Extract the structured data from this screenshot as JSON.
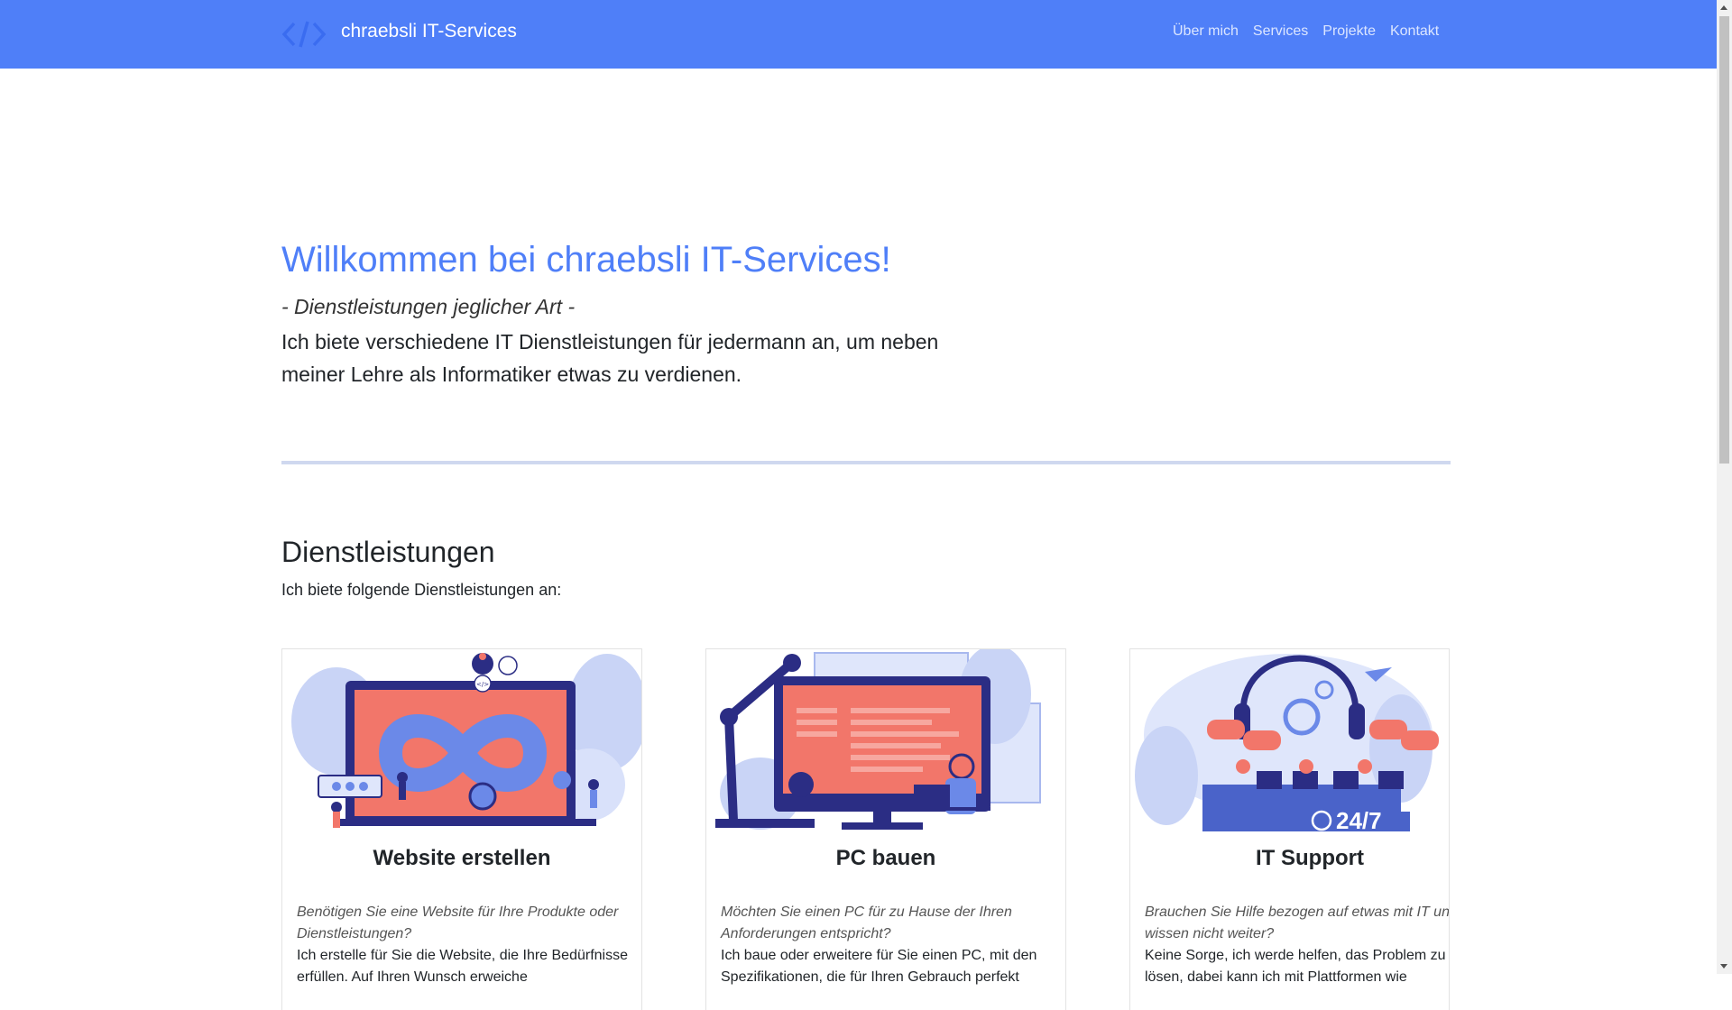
{
  "brand": {
    "name": "chraebsli IT-Services",
    "logo_icon": "code-brackets-icon"
  },
  "nav": {
    "items": [
      "Über mich",
      "Services",
      "Projekte",
      "Kontakt"
    ]
  },
  "hero": {
    "title": "Willkommen bei chraebsli IT-Services!",
    "subtitle": "- Dienstleistungen jeglicher Art -",
    "text": "Ich biete verschiedene IT Dienstleistungen für jedermann an, um neben meiner Lehre als Informatiker etwas zu verdienen."
  },
  "services": {
    "title": "Dienstleistungen",
    "subtitle": "Ich biete folgende Dienstleistungen an:",
    "cards": [
      {
        "title": "Website erstellen",
        "question": "Benötigen Sie eine Website für Ihre Produkte oder Dienstleistungen?",
        "body": "Ich erstelle für Sie die Website, die Ihre Bedürfnisse erfüllen. Auf Ihren Wunsch erweiche",
        "image_icon": "web-development-illustration-icon"
      },
      {
        "title": "PC bauen",
        "question": "Möchten Sie einen PC für zu Hause der Ihren Anforderungen entspricht?",
        "body": "Ich baue oder erweitere für Sie einen PC, mit den Spezifikationen, die für Ihren Gebrauch perfekt",
        "image_icon": "pc-building-illustration-icon"
      },
      {
        "title": "IT Support",
        "question": "Brauchen Sie Hilfe bezogen auf etwas mit IT und wissen nicht weiter?",
        "body": "Keine Sorge, ich werde helfen, das Problem zu lösen, dabei kann ich mit Plattformen wie",
        "image_icon": "it-support-illustration-icon",
        "badge": "24/7"
      }
    ]
  },
  "colors": {
    "accent": "#4f7ff8",
    "illustration_red": "#f2766a",
    "illustration_navy": "#2b2d84"
  }
}
